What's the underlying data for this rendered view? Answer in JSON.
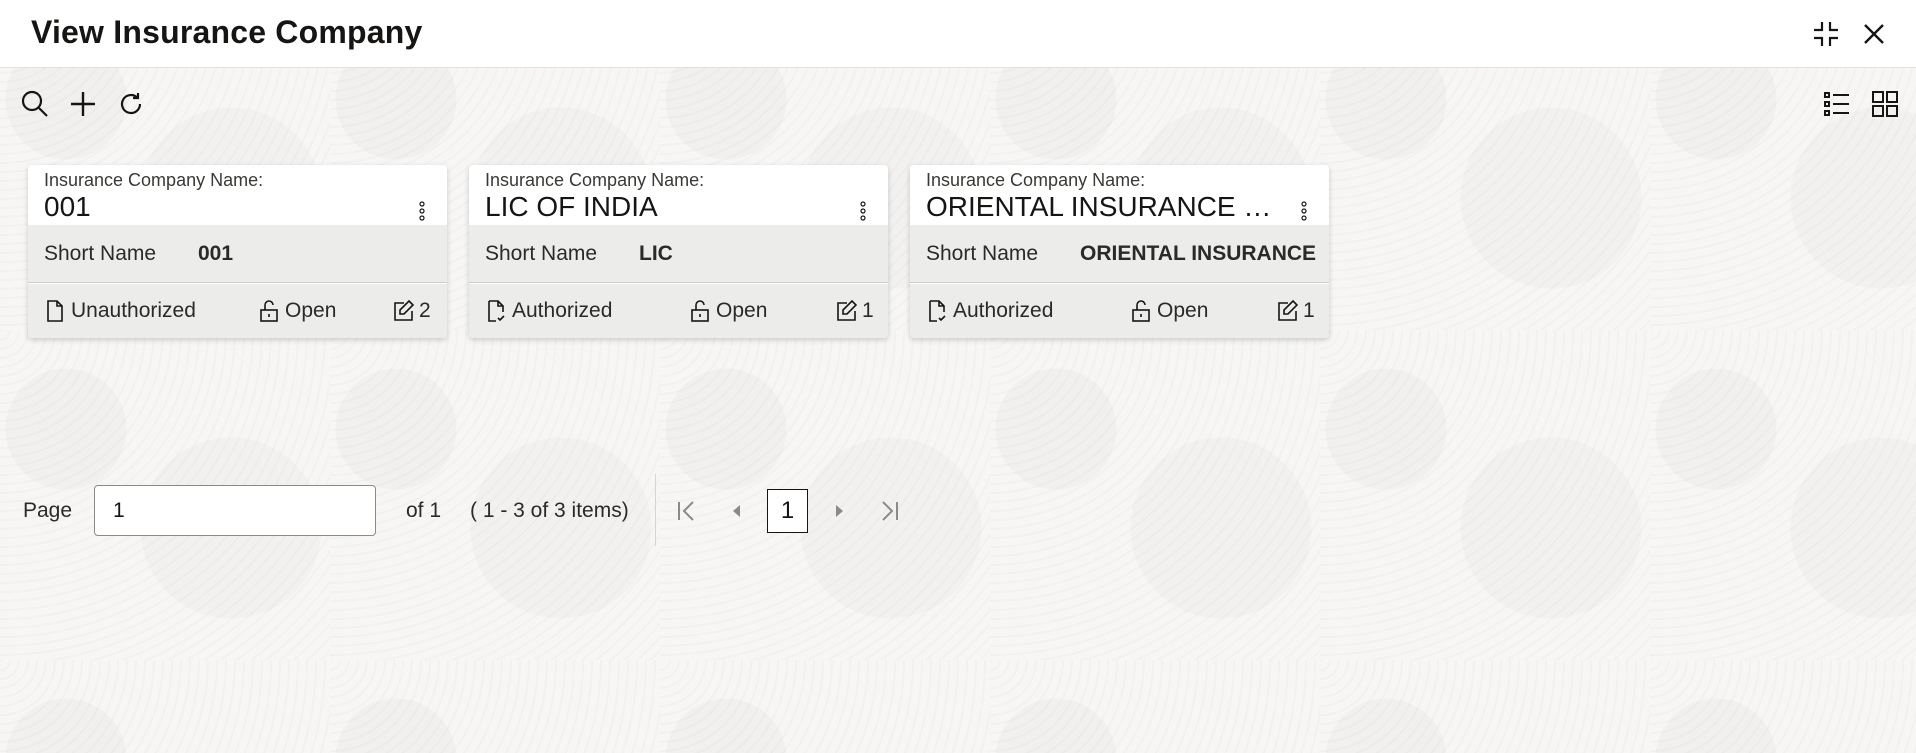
{
  "header": {
    "title": "View Insurance Company",
    "icons": {
      "minimize": "compress-icon",
      "close": "close-icon"
    }
  },
  "toolbar": {
    "icons": [
      "search-icon",
      "add-icon",
      "refresh-icon"
    ],
    "view_icons": [
      "list-view-icon",
      "grid-view-icon"
    ]
  },
  "cards": [
    {
      "label": "Insurance Company Name:",
      "name": "001",
      "short_name_label": "Short Name",
      "short_name": "001",
      "auth_status": "Unauthorized",
      "record_status": "Open",
      "modification_count": "2"
    },
    {
      "label": "Insurance Company Name:",
      "name": "LIC OF INDIA",
      "short_name_label": "Short Name",
      "short_name": "LIC",
      "auth_status": "Authorized",
      "record_status": "Open",
      "modification_count": "1"
    },
    {
      "label": "Insurance Company Name:",
      "name": "ORIENTAL INSURANCE C...",
      "short_name_label": "Short Name",
      "short_name": "ORIENTAL INSURANCE",
      "auth_status": "Authorized",
      "record_status": "Open",
      "modification_count": "1"
    }
  ],
  "pagination": {
    "page_label": "Page",
    "page_value": "1",
    "of_text": "of 1",
    "range_text": "( 1 - 3 of 3 items)",
    "current_page": "1"
  },
  "colors": {
    "text": "#161513",
    "card_bg": "#ffffff",
    "card_band": "#ececeb"
  }
}
